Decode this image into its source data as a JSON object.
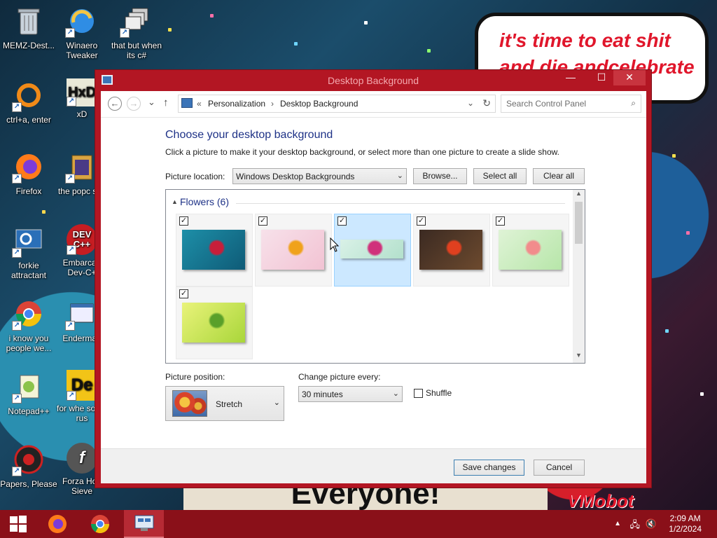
{
  "desktop": {
    "icons": [
      {
        "label": "MEMZ-Dest..."
      },
      {
        "label": "Winaero Tweaker"
      },
      {
        "label": "that but when its c#"
      },
      {
        "label": "ctrl+a, enter"
      },
      {
        "label": "xD"
      },
      {
        "label": "Firefox"
      },
      {
        "label": "the popc shit"
      },
      {
        "label": "forkie attractant"
      },
      {
        "label": "Embarcad Dev-C+"
      },
      {
        "label": "i know you people we..."
      },
      {
        "label": "Enderman"
      },
      {
        "label": "Notepad++"
      },
      {
        "label": "for whe some rus"
      },
      {
        "label": "Papers, Please"
      },
      {
        "label": "Forza Hori Sieve"
      }
    ],
    "bubble_text": "it's time to eat shit and die andcelebrate",
    "banner_text": "Everyone!",
    "brand_text": "VMobot"
  },
  "window": {
    "title": "Desktop Background",
    "controls": {
      "minimize": "—",
      "maximize": "☐",
      "close": "✕"
    },
    "nav": {
      "back": "←",
      "forward": "→",
      "dropdown": "⌄",
      "up": "↑"
    },
    "breadcrumb": {
      "prefix": "«",
      "items": [
        "Personalization",
        "Desktop Background"
      ],
      "separator": "›"
    },
    "search_placeholder": "Search Control Panel",
    "heading": "Choose your desktop background",
    "instructions": "Click a picture to make it your desktop background, or select more than one picture to create a slide show.",
    "picture_location": {
      "label": "Picture location:",
      "value": "Windows Desktop Backgrounds"
    },
    "buttons": {
      "browse": "Browse...",
      "select_all": "Select all",
      "clear_all": "Clear all"
    },
    "group": {
      "name": "Flowers (6)",
      "arrow": "▲"
    },
    "pictures": [
      {
        "checked": true,
        "selected": false,
        "colors": [
          "#1d8fa8",
          "#0f5b77",
          "#c81e3a"
        ]
      },
      {
        "checked": true,
        "selected": false,
        "colors": [
          "#f7e1ea",
          "#f2c3d3",
          "#f0a21b"
        ]
      },
      {
        "checked": true,
        "selected": true,
        "colors": [
          "#d9f1e7",
          "#b3e0cc",
          "#d0317b"
        ]
      },
      {
        "checked": true,
        "selected": false,
        "colors": [
          "#3b2a22",
          "#6d4a2e",
          "#e0401f"
        ]
      },
      {
        "checked": true,
        "selected": false,
        "colors": [
          "#dff3d6",
          "#b7e6a9",
          "#f28c8c"
        ]
      },
      {
        "checked": true,
        "selected": false,
        "colors": [
          "#e9f37a",
          "#a9d63a",
          "#5aa02a"
        ]
      }
    ],
    "picture_position": {
      "label": "Picture position:",
      "value": "Stretch"
    },
    "change_every": {
      "label": "Change picture every:",
      "value": "30 minutes"
    },
    "shuffle": {
      "label": "Shuffle",
      "checked": false
    },
    "footer": {
      "save": "Save changes",
      "cancel": "Cancel"
    }
  },
  "taskbar": {
    "start_icon": "windows-logo",
    "items": [
      "firefox",
      "chrome",
      "control-panel"
    ],
    "clock_time": "2:09 AM",
    "clock_date": "1/2/2024"
  },
  "colors": {
    "window_frame": "#b31623",
    "taskbar": "#8a1019",
    "heading_blue": "#1e3287"
  }
}
